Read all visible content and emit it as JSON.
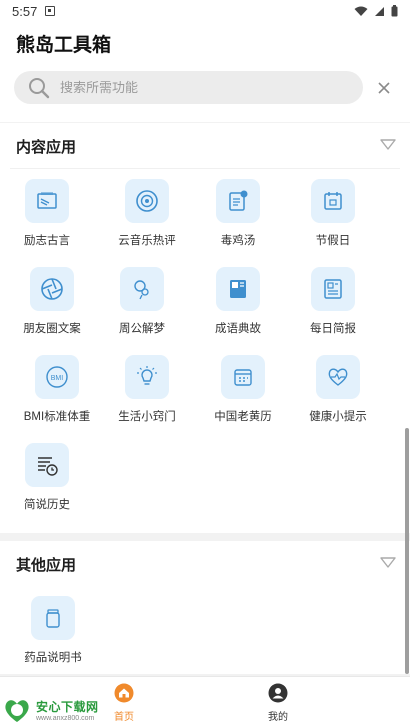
{
  "status_bar": {
    "time": "5:57"
  },
  "header": {
    "title": "熊岛工具箱"
  },
  "search": {
    "placeholder": "搜索所需功能"
  },
  "sections": [
    {
      "title": "内容应用",
      "items": [
        {
          "label": "励志古言",
          "icon": "quote-card-icon"
        },
        {
          "label": "云音乐热评",
          "icon": "music-disc-icon"
        },
        {
          "label": "毒鸡汤",
          "icon": "note-badge-icon"
        },
        {
          "label": "节假日",
          "icon": "calendar-icon"
        },
        {
          "label": "朋友圈文案",
          "icon": "aperture-icon"
        },
        {
          "label": "周公解梦",
          "icon": "dream-bubble-icon"
        },
        {
          "label": "成语典故",
          "icon": "book-icon"
        },
        {
          "label": "每日简报",
          "icon": "newspaper-icon"
        },
        {
          "label": "BMI标准体重",
          "icon": "bmi-icon"
        },
        {
          "label": "生活小窍门",
          "icon": "lightbulb-icon"
        },
        {
          "label": "中国老黄历",
          "icon": "almanac-icon"
        },
        {
          "label": "健康小提示",
          "icon": "heart-health-icon"
        },
        {
          "label": "简说历史",
          "icon": "history-list-icon"
        }
      ]
    },
    {
      "title": "其他应用",
      "items": [
        {
          "label": "药品说明书",
          "icon": "medicine-bottle-icon"
        }
      ]
    }
  ],
  "tabbar": {
    "home_label": "首页",
    "mine_label": "我的"
  },
  "watermark": {
    "main": "安心下载网",
    "sub": "www.anxz800.com"
  },
  "colors": {
    "accent": "#f08a2c",
    "icon_bg": "#e3f1fc",
    "icon_stroke": "#3f8fce"
  }
}
